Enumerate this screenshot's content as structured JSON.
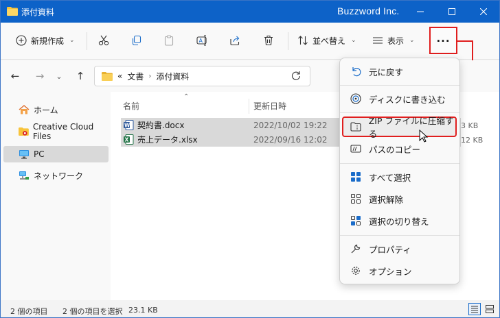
{
  "window": {
    "title": "添付資料",
    "brand": "Buzzword Inc."
  },
  "toolbar": {
    "new_label": "新規作成",
    "sort_label": "並べ替え",
    "view_label": "表示",
    "more_label": "..."
  },
  "address": {
    "root": "文書",
    "current": "添付資料",
    "prefix": "«"
  },
  "sidebar": {
    "items": [
      {
        "label": "ホーム",
        "icon": "home-icon"
      },
      {
        "label": "Creative Cloud Files",
        "icon": "creative-cloud-icon"
      },
      {
        "label": "PC",
        "icon": "pc-icon",
        "selected": true
      },
      {
        "label": "ネットワーク",
        "icon": "network-icon"
      }
    ]
  },
  "files": {
    "columns": {
      "name": "名前",
      "modified": "更新日時"
    },
    "rows": [
      {
        "name": "契約書.docx",
        "modified": "2022/10/02 19:22",
        "size": "3 KB",
        "icon": "word-file-icon"
      },
      {
        "name": "売上データ.xlsx",
        "modified": "2022/09/16 12:02",
        "size": "12 KB",
        "icon": "excel-file-icon"
      }
    ]
  },
  "menu": {
    "items": [
      {
        "label": "元に戻す",
        "icon": "undo-icon"
      },
      {
        "label": "ディスクに書き込む",
        "icon": "disc-icon"
      },
      {
        "label": "ZIP ファイルに圧縮する",
        "icon": "zip-folder-icon",
        "highlighted": true
      },
      {
        "label": "パスのコピー",
        "icon": "copy-path-icon"
      },
      {
        "label": "すべて選択",
        "icon": "select-all-icon"
      },
      {
        "label": "選択解除",
        "icon": "select-none-icon"
      },
      {
        "label": "選択の切り替え",
        "icon": "invert-selection-icon"
      },
      {
        "label": "プロパティ",
        "icon": "wrench-icon"
      },
      {
        "label": "オプション",
        "icon": "gear-icon"
      }
    ]
  },
  "status": {
    "count": "2 個の項目",
    "selected": "2 個の項目を選択",
    "size": "23.1 KB"
  },
  "colors": {
    "titlebar": "#0d62c8",
    "highlight": "#e01e1e",
    "selection": "#d9d9d9"
  }
}
